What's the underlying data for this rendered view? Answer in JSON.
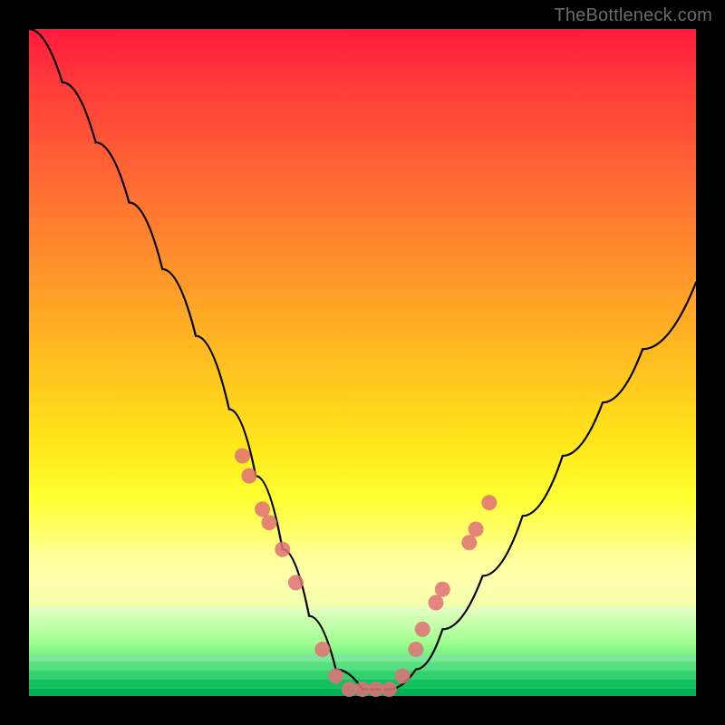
{
  "watermark": "TheBottleneck.com",
  "chart_data": {
    "type": "line",
    "title": "",
    "xlabel": "",
    "ylabel": "",
    "xlim": [
      0,
      100
    ],
    "ylim": [
      0,
      100
    ],
    "series": [
      {
        "name": "bottleneck-curve",
        "x": [
          0,
          5,
          10,
          15,
          20,
          25,
          30,
          34,
          38,
          42,
          46,
          50,
          54,
          58,
          62,
          68,
          74,
          80,
          86,
          92,
          100
        ],
        "y": [
          100,
          92,
          83,
          74,
          64,
          54,
          43,
          33,
          22,
          12,
          4,
          1,
          1,
          4,
          10,
          18,
          27,
          36,
          44,
          52,
          62
        ]
      }
    ],
    "markers": {
      "name": "highlight-dots",
      "x": [
        32,
        33,
        35,
        36,
        38,
        40,
        44,
        46,
        48,
        50,
        52,
        54,
        56,
        58,
        59,
        61,
        62,
        66,
        67,
        69
      ],
      "y": [
        36,
        33,
        28,
        26,
        22,
        17,
        7,
        3,
        1,
        1,
        1,
        1,
        3,
        7,
        10,
        14,
        16,
        23,
        25,
        29
      ]
    },
    "background_gradient": {
      "top": "#ff1a3e",
      "mid": "#ffe61a",
      "bottom": "#00c060"
    }
  }
}
